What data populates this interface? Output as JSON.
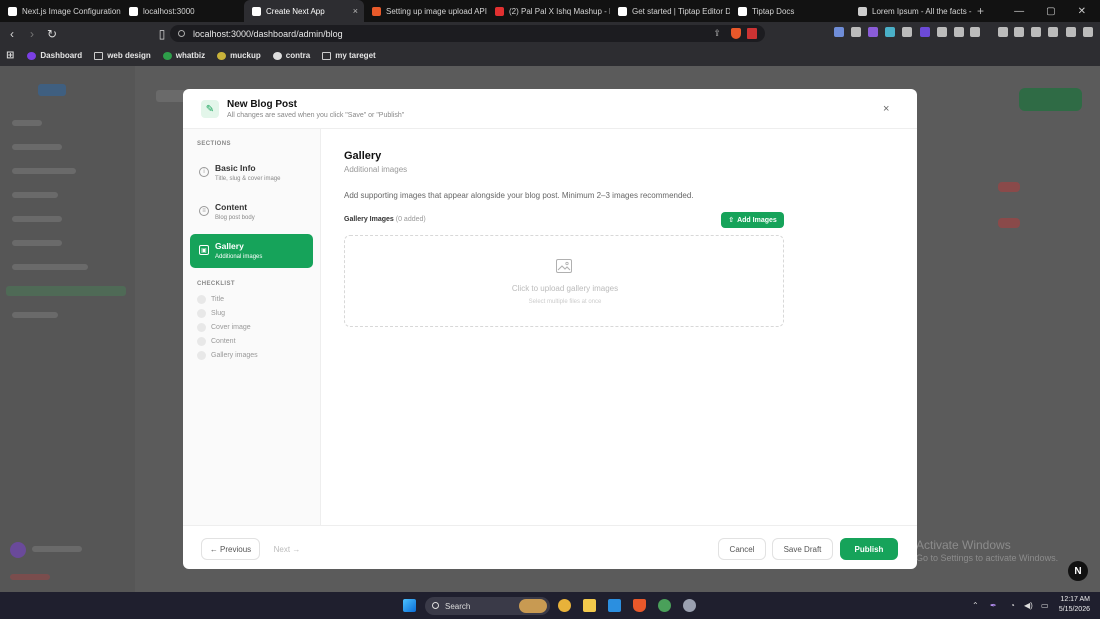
{
  "browser": {
    "tabs": [
      {
        "label": "Next.js Image Configuration",
        "fav": "#ffffff"
      },
      {
        "label": "localhost:3000",
        "fav": "#ffffff"
      },
      {
        "label": "Create Next App",
        "fav": "#ffffff",
        "active": true
      },
      {
        "label": "Setting up image upload API fl",
        "fav": "#e85a2a"
      },
      {
        "label": "(2) Pal Pal X Ishq Mashup - Pil",
        "fav": "#e23030"
      },
      {
        "label": "Get started | Tiptap Editor Doc",
        "fav": "#ffffff"
      },
      {
        "label": "Tiptap Docs",
        "fav": "#ffffff"
      },
      {
        "label": "Lorem Ipsum - All the facts - Li",
        "fav": "#cccccc"
      }
    ],
    "tab_close": "×",
    "new_tab": "+",
    "window_controls": [
      "—",
      "▢",
      "✕"
    ],
    "url": "localhost:3000/dashboard/admin/blog",
    "bookmarks": [
      {
        "label": "Dashboard",
        "icon": "dashboard-icon"
      },
      {
        "label": "web design",
        "icon": "folder-icon"
      },
      {
        "label": "whatbiz",
        "icon": "whatbiz-icon"
      },
      {
        "label": "muckup",
        "icon": "muckup-icon"
      },
      {
        "label": "contra",
        "icon": "contra-icon"
      },
      {
        "label": "my tareget",
        "icon": "folder-icon"
      }
    ]
  },
  "modal": {
    "title": "New Blog Post",
    "subtitle": "All changes are saved when you click \"Save\" or \"Publish\"",
    "close": "×",
    "sections_label": "SECTIONS",
    "nav": [
      {
        "label": "Basic Info",
        "sub": "Title, slug & cover image",
        "icon": "info-icon",
        "glyph": "i"
      },
      {
        "label": "Content",
        "sub": "Blog post body",
        "icon": "document-icon",
        "glyph": "≡"
      },
      {
        "label": "Gallery",
        "sub": "Additional images",
        "icon": "image-icon",
        "glyph": "▣",
        "active": true
      }
    ],
    "checklist_label": "CHECKLIST",
    "checklist": [
      "Title",
      "Slug",
      "Cover image",
      "Content",
      "Gallery images"
    ],
    "main": {
      "heading": "Gallery",
      "subheading": "Additional images",
      "description": "Add supporting images that appear alongside your blog post. Minimum 2–3 images recommended.",
      "gallery_label": "Gallery Images",
      "gallery_count": "(0 added)",
      "add_button": "Add Images",
      "dropzone_title": "Click to upload gallery images",
      "dropzone_sub": "Select multiple files at once"
    },
    "footer": {
      "previous": "← Previous",
      "next": "Next →",
      "cancel": "Cancel",
      "save_draft": "Save Draft",
      "publish": "Publish"
    }
  },
  "watermark": {
    "title": "Activate Windows",
    "sub": "Go to Settings to activate Windows."
  },
  "taskbar": {
    "search": "Search",
    "time": "12:17 AM",
    "date": "5/15/2026"
  },
  "colors": {
    "accent": "#16a35a"
  }
}
